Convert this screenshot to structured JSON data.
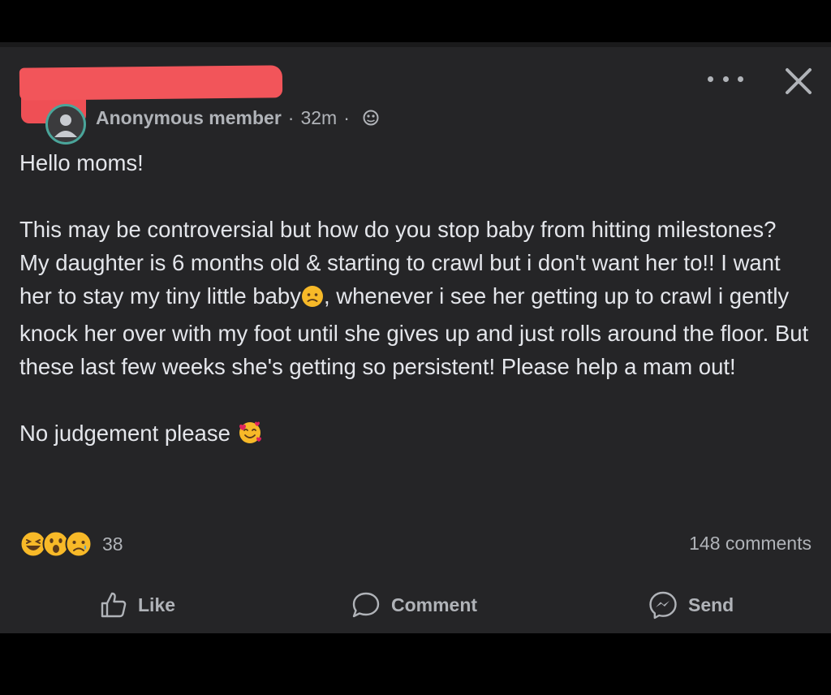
{
  "header": {
    "author": "Anonymous member",
    "time": "32m",
    "separator": "·"
  },
  "post": {
    "greeting": "Hello moms!",
    "paragraph_1": "This may be controversial but how do you stop baby from hitting milestones?",
    "paragraph_2_part_1": "My daughter is 6 months old & starting to crawl but i don't want her to!! I want her to stay my tiny little baby",
    "paragraph_2_part_2": ", whenever i see her getting up to crawl i gently knock her over with my foot until she gives up and just rolls around the floor. But these last few weeks she's getting so persistent! Please help a mam out!",
    "closing": "No judgement please"
  },
  "reactions": {
    "icons": [
      "haha-icon",
      "wow-icon",
      "sad-icon"
    ],
    "count": "38"
  },
  "comments": {
    "count_label": "148 comments"
  },
  "actions": {
    "like": "Like",
    "comment": "Comment",
    "send": "Send"
  },
  "colors": {
    "background": "#252527",
    "redaction": "#f2555a",
    "text": "#e4e6eb",
    "secondary_text": "#b0b3b8",
    "reaction_yellow": "#f7b928"
  }
}
